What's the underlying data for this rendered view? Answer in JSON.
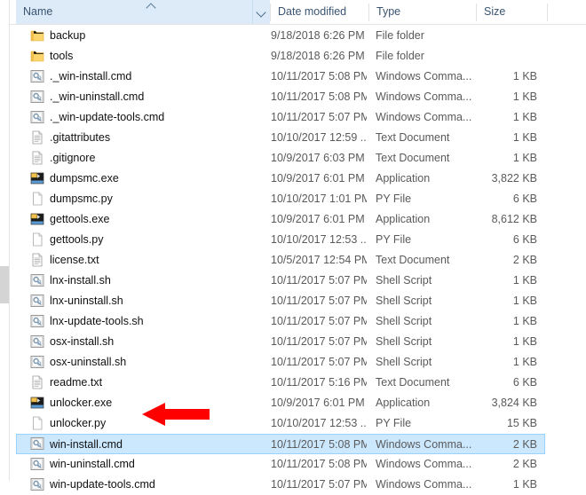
{
  "window": {
    "type": "file-explorer-list-view"
  },
  "columns": [
    {
      "id": "name",
      "label": "Name",
      "sorted": true,
      "sort_direction": "ascending"
    },
    {
      "id": "date_modified",
      "label": "Date modified"
    },
    {
      "id": "type",
      "label": "Type"
    },
    {
      "id": "size",
      "label": "Size"
    }
  ],
  "selection": {
    "selected_name": "win-install.cmd"
  },
  "annotation": {
    "kind": "arrow",
    "direction": "left",
    "color": "#ff0000",
    "points_at": "win-install.cmd"
  },
  "colors": {
    "header_sorted_bg": "#dcebf7",
    "selection_bg": "#cce8ff",
    "selection_border": "#99d1ff",
    "folder_icon": "#fcd66c",
    "annotation_red": "#ff0000"
  },
  "rows": [
    {
      "name": "backup",
      "icon": "folder-icon",
      "date": "9/18/2018 6:26 PM",
      "type": "File folder",
      "size": ""
    },
    {
      "name": "tools",
      "icon": "folder-icon",
      "date": "9/18/2018 6:26 PM",
      "type": "File folder",
      "size": ""
    },
    {
      "name": "._win-install.cmd",
      "icon": "command-script-icon",
      "date": "10/11/2017 5:08 PM",
      "type": "Windows Comma...",
      "size": "1 KB"
    },
    {
      "name": "._win-uninstall.cmd",
      "icon": "command-script-icon",
      "date": "10/11/2017 5:08 PM",
      "type": "Windows Comma...",
      "size": "1 KB"
    },
    {
      "name": "._win-update-tools.cmd",
      "icon": "command-script-icon",
      "date": "10/11/2017 5:07 PM",
      "type": "Windows Comma...",
      "size": "1 KB"
    },
    {
      "name": ".gitattributes",
      "icon": "text-document-icon",
      "date": "10/10/2017 12:59 ...",
      "type": "Text Document",
      "size": "1 KB"
    },
    {
      "name": ".gitignore",
      "icon": "text-document-icon",
      "date": "10/9/2017 6:03 PM",
      "type": "Text Document",
      "size": "1 KB"
    },
    {
      "name": "dumpsmc.exe",
      "icon": "application-icon",
      "date": "10/9/2017 6:01 PM",
      "type": "Application",
      "size": "3,822 KB"
    },
    {
      "name": "dumpsmc.py",
      "icon": "blank-file-icon",
      "date": "10/10/2017 1:01 PM",
      "type": "PY File",
      "size": "6 KB"
    },
    {
      "name": "gettools.exe",
      "icon": "application-icon",
      "date": "10/9/2017 6:01 PM",
      "type": "Application",
      "size": "8,612 KB"
    },
    {
      "name": "gettools.py",
      "icon": "blank-file-icon",
      "date": "10/10/2017 12:53 ...",
      "type": "PY File",
      "size": "6 KB"
    },
    {
      "name": "license.txt",
      "icon": "text-document-icon",
      "date": "10/5/2017 12:54 PM",
      "type": "Text Document",
      "size": "2 KB"
    },
    {
      "name": "lnx-install.sh",
      "icon": "shell-script-icon",
      "date": "10/11/2017 5:07 PM",
      "type": "Shell Script",
      "size": "1 KB"
    },
    {
      "name": "lnx-uninstall.sh",
      "icon": "shell-script-icon",
      "date": "10/11/2017 5:07 PM",
      "type": "Shell Script",
      "size": "1 KB"
    },
    {
      "name": "lnx-update-tools.sh",
      "icon": "shell-script-icon",
      "date": "10/11/2017 5:07 PM",
      "type": "Shell Script",
      "size": "1 KB"
    },
    {
      "name": "osx-install.sh",
      "icon": "shell-script-icon",
      "date": "10/11/2017 5:07 PM",
      "type": "Shell Script",
      "size": "1 KB"
    },
    {
      "name": "osx-uninstall.sh",
      "icon": "shell-script-icon",
      "date": "10/11/2017 5:07 PM",
      "type": "Shell Script",
      "size": "1 KB"
    },
    {
      "name": "readme.txt",
      "icon": "text-document-icon",
      "date": "10/11/2017 5:16 PM",
      "type": "Text Document",
      "size": "6 KB"
    },
    {
      "name": "unlocker.exe",
      "icon": "application-icon",
      "date": "10/9/2017 6:01 PM",
      "type": "Application",
      "size": "3,824 KB"
    },
    {
      "name": "unlocker.py",
      "icon": "blank-file-icon",
      "date": "10/10/2017 12:53 ...",
      "type": "PY File",
      "size": "15 KB"
    },
    {
      "name": "win-install.cmd",
      "icon": "command-script-icon",
      "date": "10/11/2017 5:08 PM",
      "type": "Windows Comma...",
      "size": "2 KB",
      "selected": true
    },
    {
      "name": "win-uninstall.cmd",
      "icon": "command-script-icon",
      "date": "10/11/2017 5:08 PM",
      "type": "Windows Comma...",
      "size": "2 KB"
    },
    {
      "name": "win-update-tools.cmd",
      "icon": "command-script-icon",
      "date": "10/11/2017 5:07 PM",
      "type": "Windows Comma...",
      "size": "1 KB"
    }
  ]
}
